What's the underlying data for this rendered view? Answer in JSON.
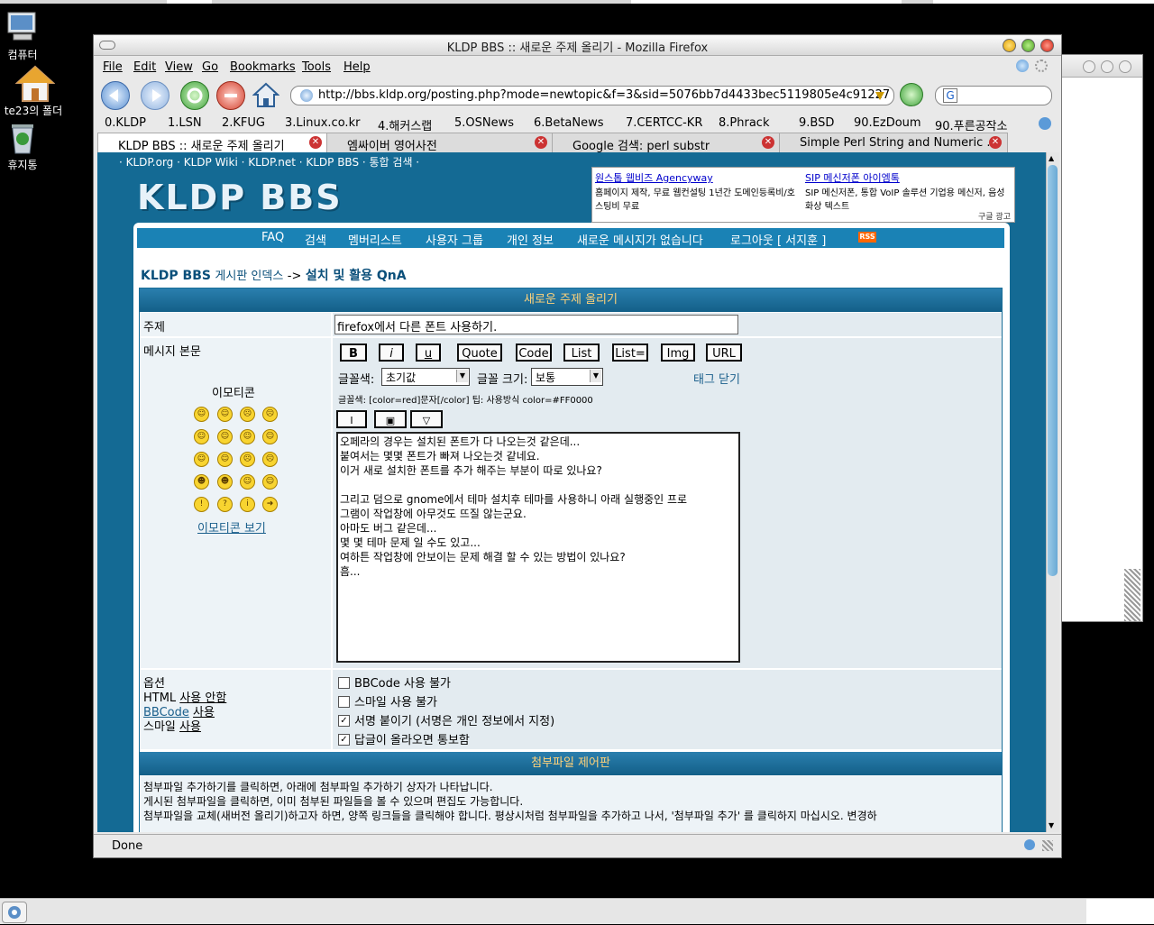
{
  "desktop": {
    "icons": [
      {
        "label": "컴퓨터"
      },
      {
        "label": "te23의 폴더"
      },
      {
        "label": "휴지통"
      }
    ]
  },
  "window": {
    "title": "KLDP BBS :: 새로운 주제 올리기 - Mozilla Firefox"
  },
  "menubar": [
    "File",
    "Edit",
    "View",
    "Go",
    "Bookmarks",
    "Tools",
    "Help"
  ],
  "navbar": {
    "url": "http://bbs.kldp.org/posting.php?mode=newtopic&f=3&sid=5076bb7d4433bec5119805e4c91227",
    "search_value": "G"
  },
  "bookmarks": [
    "0.KLDP",
    "1.LSN",
    "2.KFUG",
    "3.Linux.co.kr",
    "4.해커스랩",
    "5.OSNews",
    "6.BetaNews",
    "7.CERTCC-KR",
    "8.Phrack",
    "9.BSD",
    "90.EzDoum",
    "90.푸른공작소"
  ],
  "tabs": [
    {
      "label": "KLDP BBS :: 새로운 주제 올리기",
      "active": true
    },
    {
      "label": "엠싸이버 영어사전",
      "active": false
    },
    {
      "label": "Google 검색: perl substr",
      "active": false
    },
    {
      "label": "Simple Perl String and Numeric ...",
      "active": false
    }
  ],
  "page": {
    "toplinks": "· KLDP.org · KLDP Wiki · KLDP.net · KLDP BBS · 통합 검색 ·",
    "logo": "KLDP BBS",
    "ad": {
      "left_title": "원스톱 웹비즈 Agencyway",
      "left_text": "홈페이지 제작, 무료 웹컨설팅 1년간 도메인등록비/호스팅비 무료",
      "right_title": "SIP 메신저폰 아이엠톡",
      "right_text": "SIP 메신저폰, 통합 VoIP 솔루션 기업용 메신저, 음성 화상 텍스트",
      "footer": "구글 광고"
    },
    "nav": [
      "FAQ",
      "검색",
      "멤버리스트",
      "사용자 그룹",
      "개인 정보",
      "새로운 메시지가 없습니다",
      "로그아웃 [ 서지훈 ]"
    ],
    "rss_label": "RSS",
    "breadcrumb": {
      "home": "KLDP BBS",
      "index": "게시판 인덱스",
      "sep": "->",
      "forum": "설치 및 활용 QnA"
    },
    "form": {
      "header": "새로운 주제 올리기",
      "subject_label": "주제",
      "subject_value": "firefox에서 다른 폰트 사용하기.",
      "body_label": "메시지 본문",
      "emoticon_title": "이모티콘",
      "emoticon_more": "이모티콘 보기",
      "toolbar": [
        "B",
        "i",
        "u",
        "Quote",
        "Code",
        "List",
        "List=",
        "Img",
        "URL"
      ],
      "font_color_label": "글꼴색:",
      "font_color_value": "초기값",
      "font_size_label": "글꼴 크기:",
      "font_size_value": "보통",
      "close_tags": "태그 닫기",
      "hint": "글꼴색: [color=red]문자[/color]  팁: 사용방식 color=#FF0000",
      "mini_buttons": [
        "I",
        "▣",
        "▽"
      ],
      "body_text": "오페라의 경우는 설치된 폰트가 다 나오는것 같은데...\n붙여서는 몇몇 폰트가 빠져 나오는것 같네요.\n이거 새로 설치한 폰트를 추가 해주는 부분이 따로 있나요?\n\n그리고 덤으로 gnome에서 테마 설치후 테마를 사용하니 아래 실행중인 프로\n그램이 작업창에 아무것도 뜨질 않는군요.\n아마도 버그 같은데...\n몇 몇 테마 문제 일 수도 있고...\n여하튼 작업창에 안보이는 문제 해결 할 수 있는 방법이 있나요?\n흠...",
      "options_label": "옵션",
      "html_prefix": "HTML",
      "html_state": "사용 안함",
      "bbcode_link": "BBCode",
      "bbcode_state": "사용",
      "smile_label": "스마일",
      "smile_state": "사용",
      "options": [
        {
          "label": "BBCode 사용 불가",
          "checked": false
        },
        {
          "label": "스마일 사용 불가",
          "checked": false
        },
        {
          "label": "서명 붙이기 (서명은 개인 정보에서 지정)",
          "checked": true
        },
        {
          "label": "답글이 올라오면 통보함",
          "checked": true
        }
      ],
      "attach_header": "첨부파일 제어판",
      "attach_lines": [
        "첨부파일 추가하기를 클릭하면, 아래에 첨부파일 추가하기 상자가 나타납니다.",
        "게시된 첨부파일을 클릭하면, 이미 첨부된 파일들을 볼 수 있으며 편집도 가능합니다.",
        "첨부파일을 교체(새버전 올리기)하고자 하면, 양쪽 링크들을 클릭해야 합니다. 평상시처럼 첨부파일을 추가하고 나서, '첨부파일 추가' 를 클릭하지 마십시오. 변경하"
      ]
    }
  },
  "statusbar": {
    "text": "Done"
  },
  "colors": {
    "accent": "#146a94",
    "header_text": "#ffd27a",
    "nav": "#1a82b5"
  },
  "icons": [
    "back-icon",
    "forward-icon",
    "reload-icon",
    "stop-icon",
    "home-icon",
    "go-icon",
    "close-tab-icon",
    "smiley-icon",
    "checkbox-icon"
  ]
}
